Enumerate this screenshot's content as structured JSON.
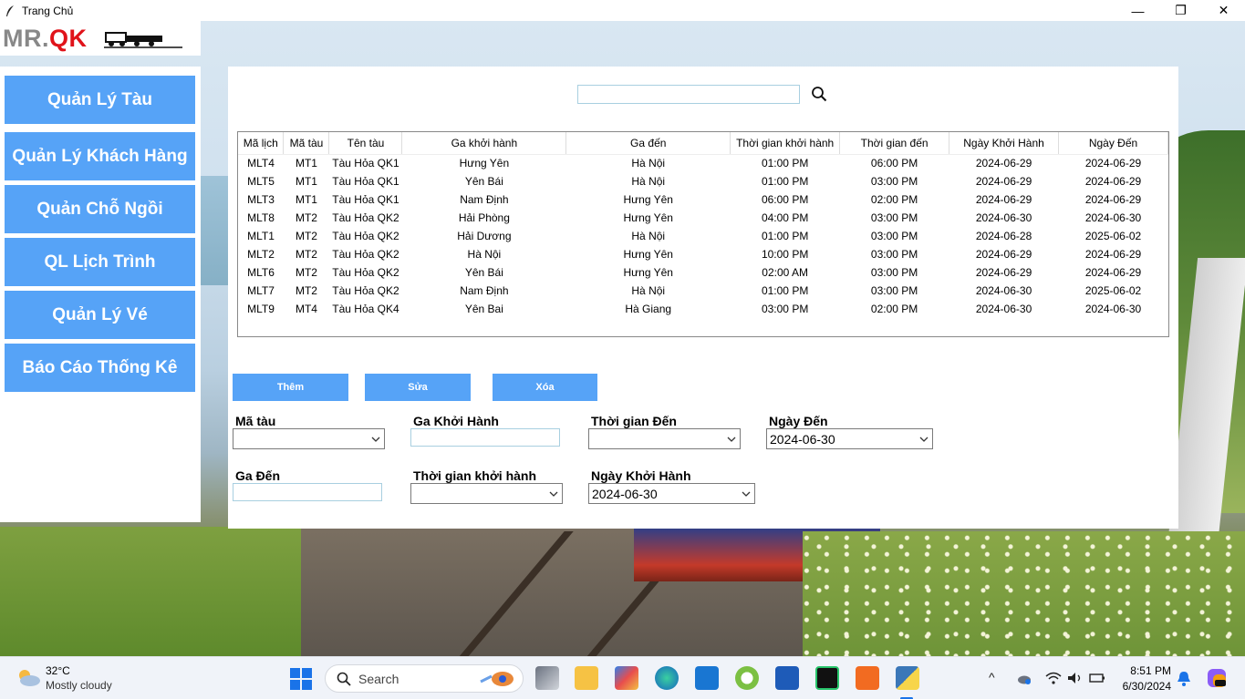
{
  "window": {
    "title": "Trang Chủ",
    "minimize": "—",
    "maximize": "❐",
    "close": "✕"
  },
  "logo": {
    "mr": "MR.",
    "qk": "QK"
  },
  "sidebar": {
    "items": [
      {
        "label": "Quản Lý Tàu"
      },
      {
        "label": "Quản Lý Khách Hàng"
      },
      {
        "label": "Quản Chỗ Ngồi"
      },
      {
        "label": "QL Lịch Trình"
      },
      {
        "label": "Quản Lý Vé"
      },
      {
        "label": "Báo Cáo Thống Kê"
      }
    ]
  },
  "search": {
    "value": "",
    "icon": "search-icon"
  },
  "table": {
    "columns": [
      "Mã lịch",
      "Mã tàu",
      "Tên tàu",
      "Ga khởi hành",
      "Ga đến",
      "Thời gian khởi hành",
      "Thời gian đến",
      "Ngày Khởi Hành",
      "Ngày Đến"
    ],
    "rows": [
      [
        "MLT4",
        "MT1",
        "Tàu Hỏa QK1",
        "Hưng Yên",
        "Hà Nội",
        "01:00 PM",
        "06:00 PM",
        "2024-06-29",
        "2024-06-29"
      ],
      [
        "MLT5",
        "MT1",
        "Tàu Hỏa QK1",
        "Yên Bái",
        "Hà Nội",
        "01:00 PM",
        "03:00 PM",
        "2024-06-29",
        "2024-06-29"
      ],
      [
        "MLT3",
        "MT1",
        "Tàu Hỏa QK1",
        "Nam Định",
        "Hưng Yên",
        "06:00 PM",
        "02:00 PM",
        "2024-06-29",
        "2024-06-29"
      ],
      [
        "MLT8",
        "MT2",
        "Tàu Hỏa QK2",
        "Hải Phòng",
        "Hưng Yên",
        "04:00 PM",
        "03:00 PM",
        "2024-06-30",
        "2024-06-30"
      ],
      [
        "MLT1",
        "MT2",
        "Tàu Hỏa QK2",
        "Hải Dương",
        "Hà Nội",
        "01:00 PM",
        "03:00 PM",
        "2024-06-28",
        "2025-06-02"
      ],
      [
        "MLT2",
        "MT2",
        "Tàu Hỏa QK2",
        "Hà Nội",
        "Hưng Yên",
        "10:00 PM",
        "03:00 PM",
        "2024-06-29",
        "2024-06-29"
      ],
      [
        "MLT6",
        "MT2",
        "Tàu Hỏa QK2",
        "Yên Bái",
        "Hưng Yên",
        "02:00 AM",
        "03:00 PM",
        "2024-06-29",
        "2024-06-29"
      ],
      [
        "MLT7",
        "MT2",
        "Tàu Hỏa QK2",
        "Nam Định",
        "Hà Nội",
        "01:00 PM",
        "03:00 PM",
        "2024-06-30",
        "2025-06-02"
      ],
      [
        "MLT9",
        "MT4",
        "Tàu Hỏa QK4",
        "Yên Bai",
        "Hà Giang",
        "03:00 PM",
        "02:00 PM",
        "2024-06-30",
        "2024-06-30"
      ]
    ]
  },
  "actions": {
    "add": "Thêm",
    "edit": "Sửa",
    "delete": "Xóa"
  },
  "form": {
    "ma_tau": {
      "label": "Mã tàu",
      "value": ""
    },
    "ga_khoi_hanh": {
      "label": "Ga Khởi Hành",
      "value": ""
    },
    "thoi_gian_den": {
      "label": "Thời gian Đến",
      "value": ""
    },
    "ngay_den": {
      "label": "Ngày Đến",
      "value": "2024-06-30"
    },
    "ga_den": {
      "label": "Ga Đến",
      "value": ""
    },
    "thoi_gian_khoi_hanh": {
      "label": "Thời gian khởi hành",
      "value": ""
    },
    "ngay_khoi_hanh": {
      "label": "Ngày Khởi Hành",
      "value": "2024-06-30"
    }
  },
  "taskbar": {
    "weather_temp": "32°C",
    "weather_desc": "Mostly cloudy",
    "search_placeholder": "Search",
    "time": "8:51 PM",
    "date": "6/30/2024"
  },
  "colors": {
    "accent": "#56a3f7",
    "logo_red": "#e0131a",
    "logo_gray": "#888888"
  }
}
